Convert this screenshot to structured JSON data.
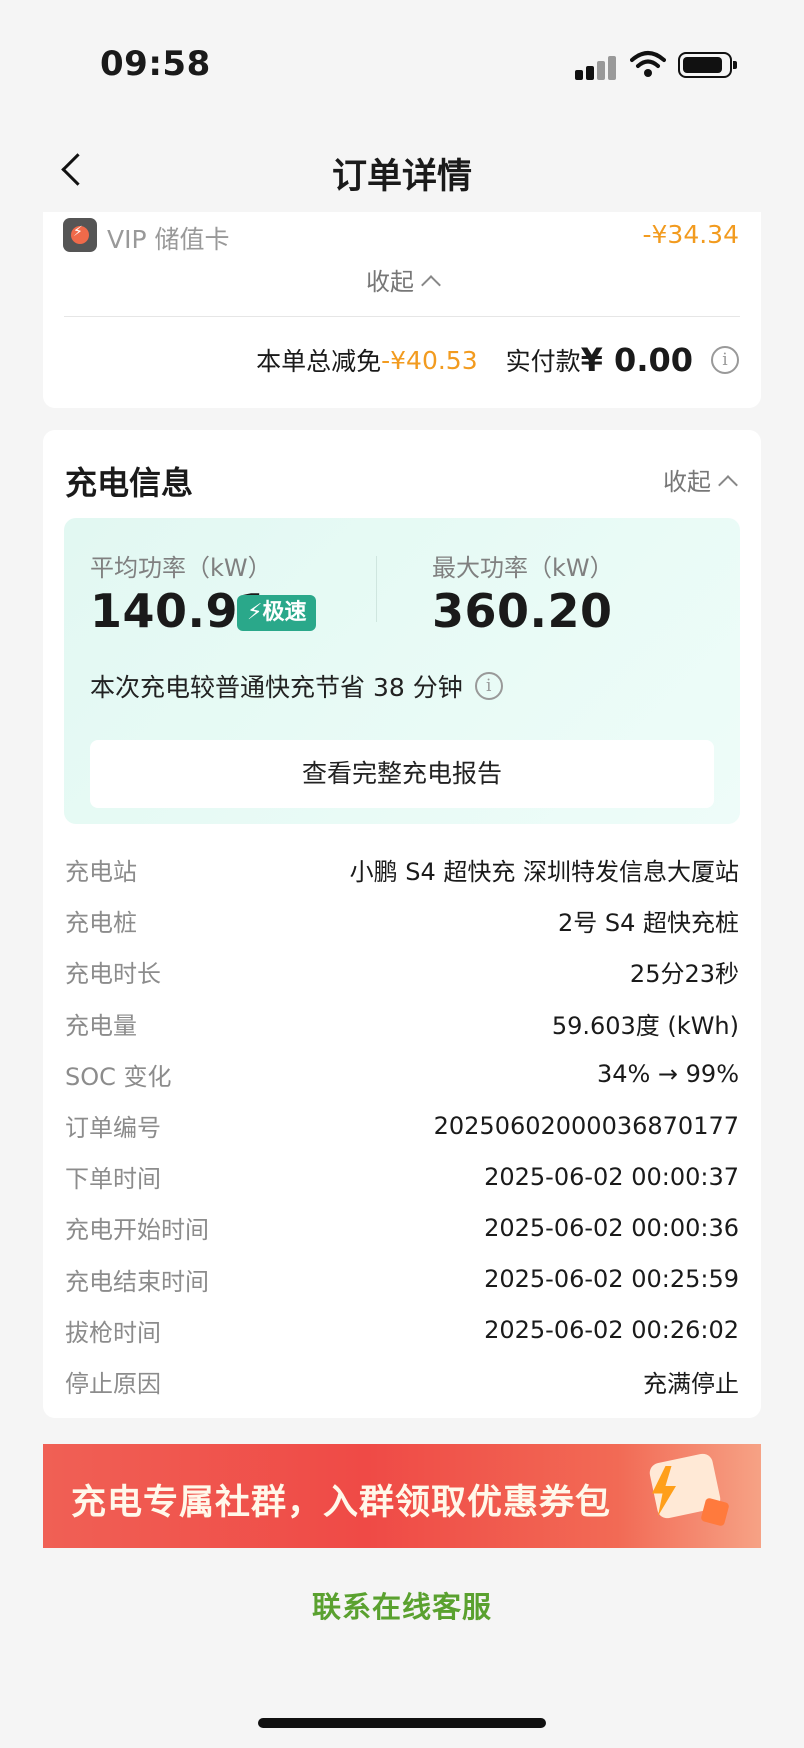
{
  "status_bar": {
    "time": "09:58"
  },
  "nav": {
    "title": "订单详情"
  },
  "discount": {
    "vip_label": "VIP 储值卡",
    "vip_amount": "-¥34.34",
    "collapse_label": "收起",
    "total_label": "本单总减免",
    "total_value": "-¥40.53",
    "paid_label": "实付款",
    "paid_value": "¥ 0.00"
  },
  "charge_info": {
    "title": "充电信息",
    "collapse_label": "收起",
    "avg_power_label": "平均功率（kW）",
    "avg_power_value": "140.91",
    "speed_badge": "⚡极速",
    "max_power_label": "最大功率（kW）",
    "max_power_value": "360.20",
    "save_note": "本次充电较普通快充节省 38 分钟",
    "report_button": "查看完整充电报告",
    "details": [
      {
        "key": "充电站",
        "value": "小鹏 S4 超快充 深圳特发信息大厦站"
      },
      {
        "key": "充电桩",
        "value": "2号 S4 超快充桩"
      },
      {
        "key": "充电时长",
        "value": "25分23秒"
      },
      {
        "key": "充电量",
        "value": "59.603度 (kWh)"
      },
      {
        "key": "SOC 变化",
        "value": "34% → 99%"
      },
      {
        "key": "订单编号",
        "value": "20250602000036870177"
      },
      {
        "key": "下单时间",
        "value": "2025-06-02 00:00:37"
      },
      {
        "key": "充电开始时间",
        "value": "2025-06-02 00:00:36"
      },
      {
        "key": "充电结束时间",
        "value": "2025-06-02 00:25:59"
      },
      {
        "key": "拔枪时间",
        "value": "2025-06-02 00:26:02"
      },
      {
        "key": "停止原因",
        "value": "充满停止"
      }
    ]
  },
  "banner": {
    "text": "充电专属社群，入群领取优惠券包"
  },
  "contact": {
    "label": "联系在线客服"
  },
  "colors": {
    "accent_orange": "#f29b1f",
    "badge_green": "#2aa88a",
    "contact_green": "#5aa12f",
    "banner_red": "#ef4a46"
  },
  "icons": [
    "back-chevron-icon",
    "signal-icon",
    "wifi-icon",
    "battery-icon",
    "vip-card-icon",
    "info-icon",
    "chevron-up-icon",
    "bolt-icon"
  ]
}
